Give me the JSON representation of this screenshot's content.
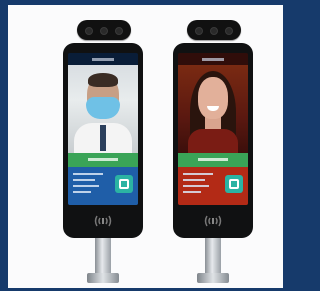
{
  "page": {
    "background_color": "#163a6b",
    "panel_color": "#fbfbfc"
  },
  "devices": [
    {
      "screen_theme": "blue",
      "status_color": "#3aa457",
      "info_color": "#1f5ea8",
      "subject": "masked-man"
    },
    {
      "screen_theme": "red",
      "status_color": "#3aa457",
      "info_color": "#b32a16",
      "subject": "smiling-woman"
    }
  ],
  "icons": {
    "camera": "camera-icon",
    "qr": "qr-code-icon",
    "nfc": "nfc-reader-icon"
  }
}
